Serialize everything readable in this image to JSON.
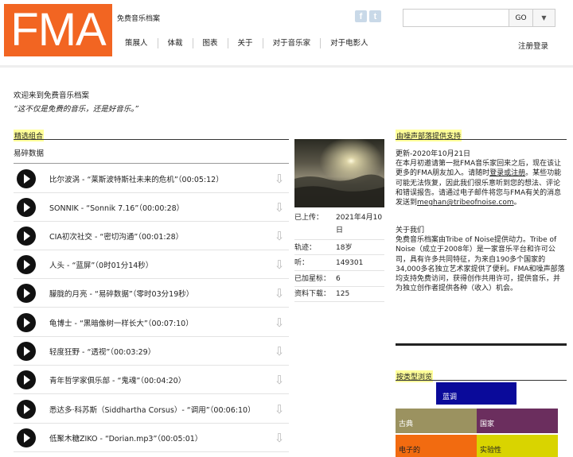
{
  "header": {
    "logo_text": "FMA",
    "site_title": "免费音乐档案",
    "social": [
      {
        "name": "facebook-icon",
        "glyph": "f"
      },
      {
        "name": "twitter-icon",
        "glyph": "t"
      }
    ],
    "search": {
      "value": "",
      "placeholder": ""
    },
    "go_label": "GO",
    "dropdown_glyph": "▼",
    "nav": [
      "策展人",
      "体裁",
      "图表",
      "关于",
      "对于音乐家",
      "对于电影人"
    ],
    "login_label": "注册登录"
  },
  "welcome": {
    "title": "欢迎来到免费音乐档案",
    "tagline": "“这不仅是免费的音乐，还是好音乐。”"
  },
  "featured": {
    "heading": "精选组合",
    "mix_title": "易碎数据",
    "tracks": [
      {
        "title": "比尔波涡 - “莱斯波特斯社未来的危机”（00:05:12）"
      },
      {
        "title": "SONNIK - “Sonnik 7.16”（00:00:28）"
      },
      {
        "title": "CIA初次社交 - “密切沟通”（00:01:28）"
      },
      {
        "title": "人头 - “蓝屏”（0时01分14秒）"
      },
      {
        "title": "朦胧的月亮 - “易碎数据”（零时03分19秒）"
      },
      {
        "title": "龟博士 - “黑暗像树一样长大”（00:07:10）"
      },
      {
        "title": "轻度狂野 - “透视”（00:03:29）"
      },
      {
        "title": "青年哲学家俱乐部 - “鬼魂”（00:04:20）"
      },
      {
        "title": "悉达多·科苏斯（Siddhartha Corsus）- “调用”（00:06:10）"
      },
      {
        "title": "低聚木糖ZIKO - “Dorian.mp3”（00:05:01）"
      }
    ],
    "info": [
      {
        "k": "已上传：",
        "v": "2021年4月10日"
      },
      {
        "k": "轨迹：",
        "v": "18岁"
      },
      {
        "k": "听：",
        "v": "149301"
      },
      {
        "k": "已加星标：",
        "v": "6"
      },
      {
        "k": "资料下载：",
        "v": "125"
      }
    ]
  },
  "support": {
    "heading": "由噪声部落提供支持",
    "update_title": "更新-2020年10月21日",
    "update_body_1": "在本月初邀请第一批FMA音乐家回来之后，现在该让更多的FMA朋友加入。请随时",
    "update_link": "登录或注册",
    "update_body_2": "。某些功能可能无法恢复，因此我们很乐意听到您的想法、评论和错误报告。请通过电子邮件将您与FMA有关的消息发送到",
    "update_email": "meghan@tribeofnoise.com",
    "update_body_3": "。",
    "about_title": "关于我们",
    "about_body": "免费音乐档案由Tribe of Noise提供动力。Tribe of Noise（成立于2008年）是一家音乐平台和许可公司，具有许多共同特征，为来自190多个国家的34,000多名独立艺术家提供了便利。FMA和噪声部落均支持免费访问，获得创作共用许可，提供音乐，并为独立创作者提供各种（收入）机会。"
  },
  "genres": {
    "heading": "按类型浏览",
    "items": [
      {
        "label": "蓝调",
        "color": "#0a0a9a"
      },
      {
        "label": "古典",
        "color": "#9b9260"
      },
      {
        "label": "国家",
        "color": "#6b2e5e"
      },
      {
        "label": "电子的",
        "color": "#f26b10"
      },
      {
        "label": "实验性",
        "color": "#d9d400"
      }
    ]
  }
}
